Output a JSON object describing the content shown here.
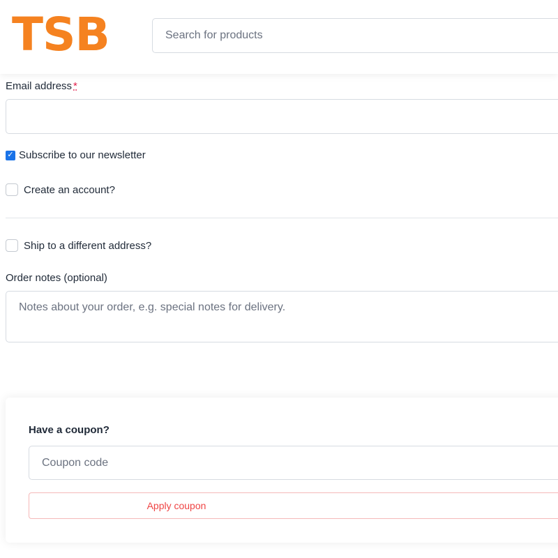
{
  "header": {
    "logo_text": "TSB",
    "search_placeholder": "Search for products"
  },
  "form": {
    "email_label": "Email address",
    "email_required_mark": "*",
    "email_value": "",
    "newsletter_label": "Subscribe to our newsletter",
    "newsletter_checked": true,
    "create_account_label": "Create an account?",
    "create_account_checked": false,
    "ship_different_label": "Ship to a different address?",
    "ship_different_checked": false,
    "order_notes_label": "Order notes (optional)",
    "order_notes_placeholder": "Notes about your order, e.g. special notes for delivery."
  },
  "coupon": {
    "title": "Have a coupon?",
    "input_placeholder": "Coupon code",
    "apply_label": "Apply coupon"
  },
  "colors": {
    "brand": "#f58220",
    "checkbox_accent": "#1a73e8",
    "required": "#e11d48",
    "apply_button_text": "#ef4444"
  }
}
